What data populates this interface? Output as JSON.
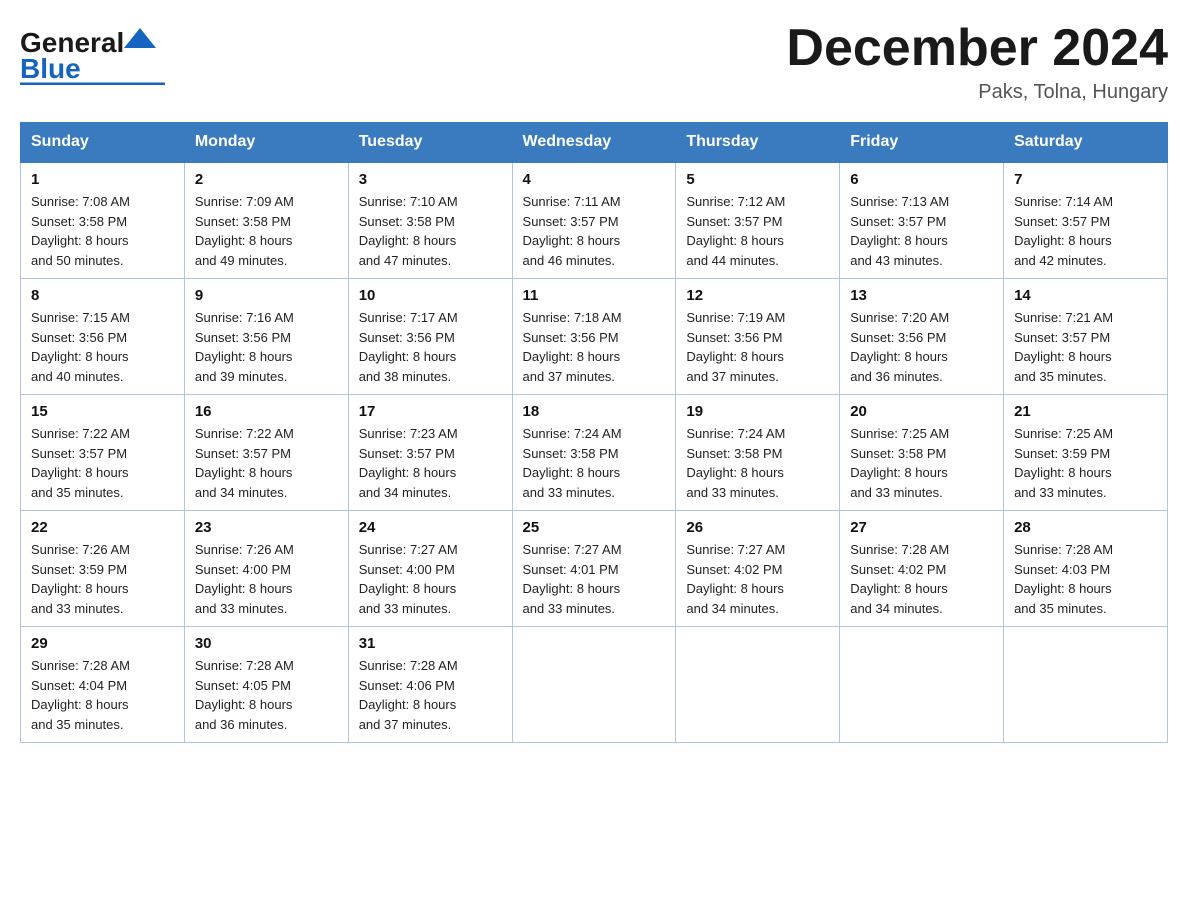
{
  "header": {
    "logo": {
      "line1": "General",
      "triangle": "▶",
      "line2": "Blue"
    },
    "title": "December 2024",
    "subtitle": "Paks, Tolna, Hungary"
  },
  "calendar": {
    "days_of_week": [
      "Sunday",
      "Monday",
      "Tuesday",
      "Wednesday",
      "Thursday",
      "Friday",
      "Saturday"
    ],
    "weeks": [
      [
        {
          "day": "1",
          "sunrise": "7:08 AM",
          "sunset": "3:58 PM",
          "daylight": "8 hours and 50 minutes."
        },
        {
          "day": "2",
          "sunrise": "7:09 AM",
          "sunset": "3:58 PM",
          "daylight": "8 hours and 49 minutes."
        },
        {
          "day": "3",
          "sunrise": "7:10 AM",
          "sunset": "3:58 PM",
          "daylight": "8 hours and 47 minutes."
        },
        {
          "day": "4",
          "sunrise": "7:11 AM",
          "sunset": "3:57 PM",
          "daylight": "8 hours and 46 minutes."
        },
        {
          "day": "5",
          "sunrise": "7:12 AM",
          "sunset": "3:57 PM",
          "daylight": "8 hours and 44 minutes."
        },
        {
          "day": "6",
          "sunrise": "7:13 AM",
          "sunset": "3:57 PM",
          "daylight": "8 hours and 43 minutes."
        },
        {
          "day": "7",
          "sunrise": "7:14 AM",
          "sunset": "3:57 PM",
          "daylight": "8 hours and 42 minutes."
        }
      ],
      [
        {
          "day": "8",
          "sunrise": "7:15 AM",
          "sunset": "3:56 PM",
          "daylight": "8 hours and 40 minutes."
        },
        {
          "day": "9",
          "sunrise": "7:16 AM",
          "sunset": "3:56 PM",
          "daylight": "8 hours and 39 minutes."
        },
        {
          "day": "10",
          "sunrise": "7:17 AM",
          "sunset": "3:56 PM",
          "daylight": "8 hours and 38 minutes."
        },
        {
          "day": "11",
          "sunrise": "7:18 AM",
          "sunset": "3:56 PM",
          "daylight": "8 hours and 37 minutes."
        },
        {
          "day": "12",
          "sunrise": "7:19 AM",
          "sunset": "3:56 PM",
          "daylight": "8 hours and 37 minutes."
        },
        {
          "day": "13",
          "sunrise": "7:20 AM",
          "sunset": "3:56 PM",
          "daylight": "8 hours and 36 minutes."
        },
        {
          "day": "14",
          "sunrise": "7:21 AM",
          "sunset": "3:57 PM",
          "daylight": "8 hours and 35 minutes."
        }
      ],
      [
        {
          "day": "15",
          "sunrise": "7:22 AM",
          "sunset": "3:57 PM",
          "daylight": "8 hours and 35 minutes."
        },
        {
          "day": "16",
          "sunrise": "7:22 AM",
          "sunset": "3:57 PM",
          "daylight": "8 hours and 34 minutes."
        },
        {
          "day": "17",
          "sunrise": "7:23 AM",
          "sunset": "3:57 PM",
          "daylight": "8 hours and 34 minutes."
        },
        {
          "day": "18",
          "sunrise": "7:24 AM",
          "sunset": "3:58 PM",
          "daylight": "8 hours and 33 minutes."
        },
        {
          "day": "19",
          "sunrise": "7:24 AM",
          "sunset": "3:58 PM",
          "daylight": "8 hours and 33 minutes."
        },
        {
          "day": "20",
          "sunrise": "7:25 AM",
          "sunset": "3:58 PM",
          "daylight": "8 hours and 33 minutes."
        },
        {
          "day": "21",
          "sunrise": "7:25 AM",
          "sunset": "3:59 PM",
          "daylight": "8 hours and 33 minutes."
        }
      ],
      [
        {
          "day": "22",
          "sunrise": "7:26 AM",
          "sunset": "3:59 PM",
          "daylight": "8 hours and 33 minutes."
        },
        {
          "day": "23",
          "sunrise": "7:26 AM",
          "sunset": "4:00 PM",
          "daylight": "8 hours and 33 minutes."
        },
        {
          "day": "24",
          "sunrise": "7:27 AM",
          "sunset": "4:00 PM",
          "daylight": "8 hours and 33 minutes."
        },
        {
          "day": "25",
          "sunrise": "7:27 AM",
          "sunset": "4:01 PM",
          "daylight": "8 hours and 33 minutes."
        },
        {
          "day": "26",
          "sunrise": "7:27 AM",
          "sunset": "4:02 PM",
          "daylight": "8 hours and 34 minutes."
        },
        {
          "day": "27",
          "sunrise": "7:28 AM",
          "sunset": "4:02 PM",
          "daylight": "8 hours and 34 minutes."
        },
        {
          "day": "28",
          "sunrise": "7:28 AM",
          "sunset": "4:03 PM",
          "daylight": "8 hours and 35 minutes."
        }
      ],
      [
        {
          "day": "29",
          "sunrise": "7:28 AM",
          "sunset": "4:04 PM",
          "daylight": "8 hours and 35 minutes."
        },
        {
          "day": "30",
          "sunrise": "7:28 AM",
          "sunset": "4:05 PM",
          "daylight": "8 hours and 36 minutes."
        },
        {
          "day": "31",
          "sunrise": "7:28 AM",
          "sunset": "4:06 PM",
          "daylight": "8 hours and 37 minutes."
        },
        null,
        null,
        null,
        null
      ]
    ],
    "sunrise_label": "Sunrise:",
    "sunset_label": "Sunset:",
    "daylight_label": "Daylight:"
  }
}
